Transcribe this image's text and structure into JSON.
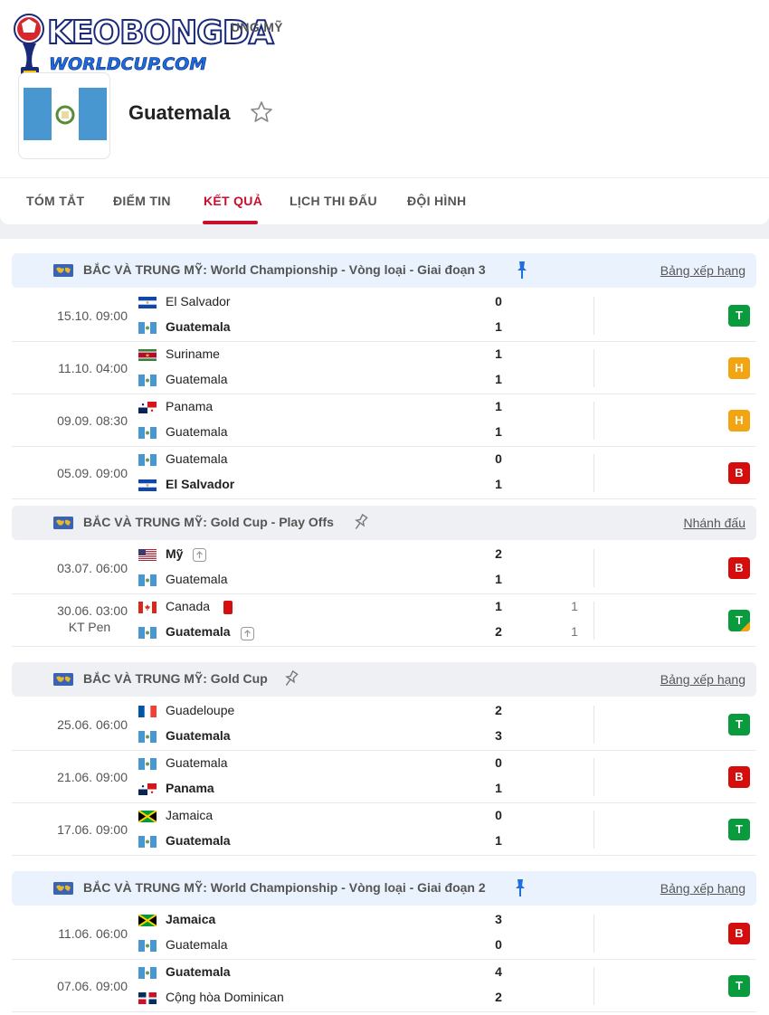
{
  "header": {
    "logo_line1": "KEOBONGDA",
    "logo_line2": "WORLDCUP.COM",
    "breadcrumb": "UNG MỸ",
    "team_name": "Guatemala"
  },
  "tabs": [
    {
      "label": "TÓM TẮT"
    },
    {
      "label": "ĐIỂM TIN"
    },
    {
      "label": "KẾT QUẢ"
    },
    {
      "label": "LỊCH THI ĐẤU"
    },
    {
      "label": "ĐỘI HÌNH"
    }
  ],
  "colors": {
    "accent": "#c8102e",
    "win": "#0a9b3e",
    "draw": "#f2a413",
    "loss": "#d60d0d"
  },
  "leagues": [
    {
      "name": "BẮC VÀ TRUNG MỸ: World Championship - Vòng loại - Giai đoạn 3",
      "link": "Bảng xếp hạng",
      "pinned": true,
      "matches": [
        {
          "time": "15.10. 09:00",
          "home": "El Salvador",
          "away": "Guatemala",
          "home_score": "0",
          "away_score": "1",
          "result": "T"
        },
        {
          "time": "11.10. 04:00",
          "home": "Suriname",
          "away": "Guatemala",
          "home_score": "1",
          "away_score": "1",
          "result": "H"
        },
        {
          "time": "09.09. 08:30",
          "home": "Panama",
          "away": "Guatemala",
          "home_score": "1",
          "away_score": "1",
          "result": "H"
        },
        {
          "time": "05.09. 09:00",
          "home": "Guatemala",
          "away": "El Salvador",
          "home_score": "0",
          "away_score": "1",
          "result": "B"
        }
      ]
    },
    {
      "name": "BẮC VÀ TRUNG MỸ: Gold Cup - Play Offs",
      "link": "Nhánh đấu",
      "pinned": false,
      "matches": [
        {
          "time": "03.07. 06:00",
          "home": "Mỹ",
          "away": "Guatemala",
          "home_score": "2",
          "away_score": "1",
          "result": "B"
        },
        {
          "time": "30.06. 03:00",
          "time_note": "KT Pen",
          "home": "Canada",
          "away": "Guatemala",
          "home_score": "1",
          "away_score": "2",
          "home_pen": "1",
          "away_pen": "1",
          "result": "T"
        }
      ]
    },
    {
      "name": "BẮC VÀ TRUNG MỸ: Gold Cup",
      "link": "Bảng xếp hạng",
      "pinned": false,
      "matches": [
        {
          "time": "25.06. 06:00",
          "home": "Guadeloupe",
          "away": "Guatemala",
          "home_score": "2",
          "away_score": "3",
          "result": "T"
        },
        {
          "time": "21.06. 09:00",
          "home": "Guatemala",
          "away": "Panama",
          "home_score": "0",
          "away_score": "1",
          "result": "B"
        },
        {
          "time": "17.06. 09:00",
          "home": "Jamaica",
          "away": "Guatemala",
          "home_score": "0",
          "away_score": "1",
          "result": "T"
        }
      ]
    },
    {
      "name": "BẮC VÀ TRUNG MỸ: World Championship - Vòng loại - Giai đoạn 2",
      "link": "Bảng xếp hạng",
      "pinned": true,
      "matches": [
        {
          "time": "11.06. 06:00",
          "home": "Jamaica",
          "away": "Guatemala",
          "home_score": "3",
          "away_score": "0",
          "result": "B"
        },
        {
          "time": "07.06. 09:00",
          "home": "Guatemala",
          "away": "Cộng hòa Dominican",
          "home_score": "4",
          "away_score": "2",
          "result": "T"
        }
      ]
    }
  ]
}
